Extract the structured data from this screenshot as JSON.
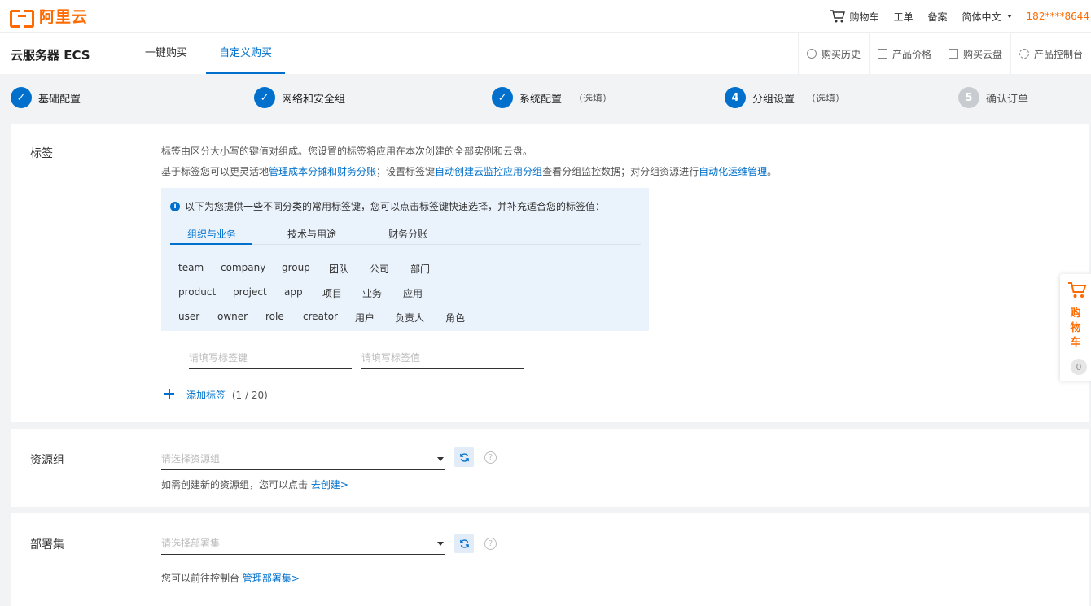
{
  "topbar": {
    "logo_text": "阿里云",
    "cart": "购物车",
    "ticket": "工单",
    "filing": "备案",
    "language": "简体中文",
    "phone": "182****8644"
  },
  "header": {
    "product": "云服务器 ECS",
    "tabs": [
      {
        "label": "一键购买",
        "active": false
      },
      {
        "label": "自定义购买",
        "active": true
      }
    ],
    "actions": [
      "购买历史",
      "产品价格",
      "购买云盘",
      "产品控制台"
    ]
  },
  "steps": [
    {
      "num": "✓",
      "label": "基础配置",
      "optional": "",
      "state": "done"
    },
    {
      "num": "✓",
      "label": "网络和安全组",
      "optional": "",
      "state": "done"
    },
    {
      "num": "✓",
      "label": "系统配置",
      "optional": "（选填）",
      "state": "done"
    },
    {
      "num": "4",
      "label": "分组设置",
      "optional": "（选填）",
      "state": "current"
    },
    {
      "num": "5",
      "label": "确认订单",
      "optional": "",
      "state": "todo"
    }
  ],
  "tags": {
    "label": "标签",
    "desc1": "标签由区分大小写的键值对组成。您设置的标签将应用在本次创建的全部实例和云盘。",
    "desc2_a": "基于标签您可以更灵活地",
    "desc2_link1": "管理成本分摊和财务分账",
    "desc2_b": "；设置标签键",
    "desc2_link2": "自动创建云监控应用分组",
    "desc2_c": "查看分组监控数据；对分组资源进行",
    "desc2_link3": "自动化运维管理",
    "desc2_d": "。",
    "tip": "以下为您提供一些不同分类的常用标签键，您可以点击标签键快速选择，并补充适合您的标签值：",
    "tip_tabs": [
      "组织与业务",
      "技术与用途",
      "财务分账"
    ],
    "keywords": [
      [
        "team",
        "company",
        "group",
        "团队",
        "公司",
        "部门"
      ],
      [
        "product",
        "project",
        "app",
        "项目",
        "业务",
        "应用"
      ],
      [
        "user",
        "owner",
        "role",
        "creator",
        "用户",
        "负责人",
        "角色"
      ]
    ],
    "key_placeholder": "请填写标签键",
    "value_placeholder": "请填写标签值",
    "add_label": "添加标签",
    "add_count": "(1 / 20)"
  },
  "resource_group": {
    "label": "资源组",
    "placeholder": "请选择资源组",
    "hint": "如需创建新的资源组，您可以点击",
    "hint_link": "去创建>"
  },
  "deployment_set": {
    "label": "部署集",
    "placeholder": "请选择部署集",
    "hint": "您可以前往控制台",
    "hint_link": "管理部署集>"
  },
  "side_cart": {
    "label": "购物车",
    "count": "0"
  },
  "colors": {
    "brand": "#ff6a00",
    "accent": "#0070cc"
  }
}
